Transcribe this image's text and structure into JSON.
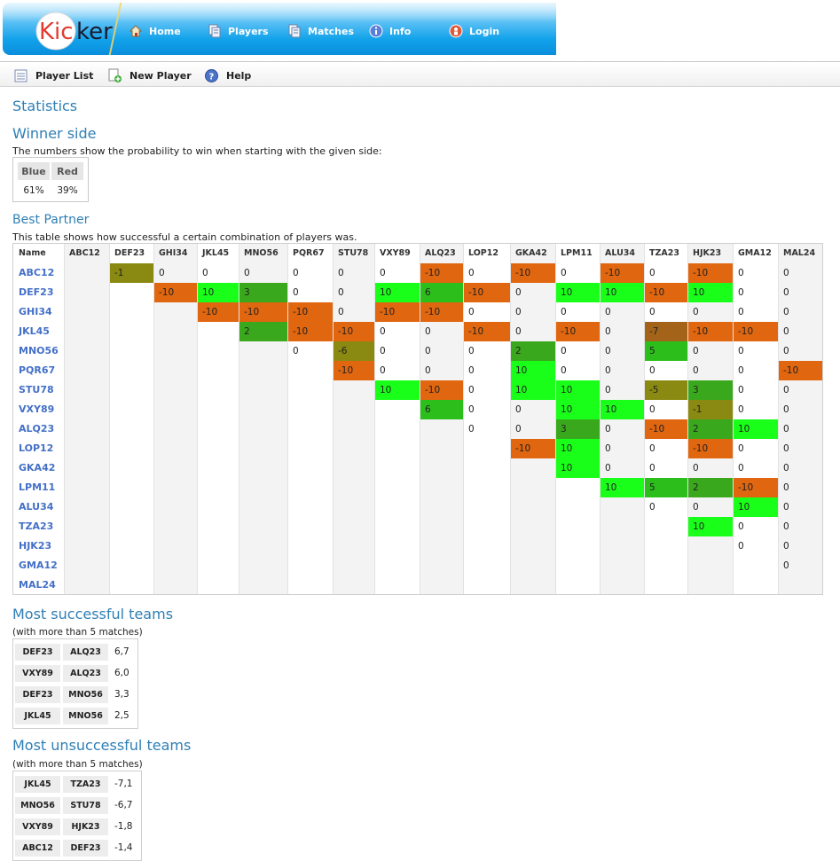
{
  "header": {
    "logo_text_left": "Kic",
    "logo_text_right": "ker",
    "nav": [
      {
        "label": "Home",
        "icon": "home-icon"
      },
      {
        "label": "Players",
        "icon": "document-icon"
      },
      {
        "label": "Matches",
        "icon": "document-icon"
      },
      {
        "label": "Info",
        "icon": "info-icon"
      },
      {
        "label": "Login",
        "icon": "login-icon"
      }
    ]
  },
  "toolbar": {
    "items": [
      {
        "label": "Player List",
        "icon": "list-icon"
      },
      {
        "label": "New Player",
        "icon": "add-document-icon"
      },
      {
        "label": "Help",
        "icon": "help-icon"
      }
    ]
  },
  "statistics": {
    "title": "Statistics",
    "winner_side": {
      "title": "Winner side",
      "description": "The numbers show the probability to win when starting with the given side:",
      "headers": [
        "Blue",
        "Red"
      ],
      "values": [
        "61%",
        "39%"
      ]
    },
    "best_partner": {
      "title": "Best Partner",
      "description": "This table shows how successful a certain combination of players was.",
      "name_header": "Name",
      "players": [
        "ABC12",
        "DEF23",
        "GHI34",
        "JKL45",
        "MNO56",
        "PQR67",
        "STU78",
        "VXY89",
        "ALQ23",
        "LOP12",
        "GKA42",
        "LPM11",
        "ALU34",
        "TZA23",
        "HJK23",
        "GMA12",
        "MAL24"
      ],
      "matrix": [
        [
          null,
          "-1",
          "0",
          "0",
          "0",
          "0",
          "0",
          "0",
          "-10",
          "0",
          "-10",
          "0",
          "-10",
          "0",
          "-10",
          "0",
          "0"
        ],
        [
          null,
          null,
          "-10",
          "10",
          "3",
          "0",
          "0",
          "10",
          "6",
          "-10",
          "0",
          "10",
          "10",
          "-10",
          "10",
          "0",
          "0"
        ],
        [
          null,
          null,
          null,
          "-10",
          "-10",
          "-10",
          "0",
          "-10",
          "-10",
          "0",
          "0",
          "0",
          "0",
          "0",
          "0",
          "0",
          "0"
        ],
        [
          null,
          null,
          null,
          null,
          "2",
          "-10",
          "-10",
          "0",
          "0",
          "-10",
          "0",
          "-10",
          "0",
          "-7",
          "-10",
          "-10",
          "0"
        ],
        [
          null,
          null,
          null,
          null,
          null,
          "0",
          "-6",
          "0",
          "0",
          "0",
          "2",
          "0",
          "0",
          "5",
          "0",
          "0",
          "0"
        ],
        [
          null,
          null,
          null,
          null,
          null,
          null,
          "-10",
          "0",
          "0",
          "0",
          "10",
          "0",
          "0",
          "0",
          "0",
          "0",
          "-10"
        ],
        [
          null,
          null,
          null,
          null,
          null,
          null,
          null,
          "10",
          "-10",
          "0",
          "10",
          "10",
          "0",
          "-5",
          "3",
          "0",
          "0"
        ],
        [
          null,
          null,
          null,
          null,
          null,
          null,
          null,
          null,
          "6",
          "0",
          "0",
          "10",
          "10",
          "0",
          "-1",
          "0",
          "0"
        ],
        [
          null,
          null,
          null,
          null,
          null,
          null,
          null,
          null,
          null,
          "0",
          "0",
          "3",
          "0",
          "-10",
          "2",
          "10",
          "0"
        ],
        [
          null,
          null,
          null,
          null,
          null,
          null,
          null,
          null,
          null,
          null,
          "-10",
          "10",
          "0",
          "0",
          "-10",
          "0",
          "0"
        ],
        [
          null,
          null,
          null,
          null,
          null,
          null,
          null,
          null,
          null,
          null,
          null,
          "10",
          "0",
          "0",
          "0",
          "0",
          "0"
        ],
        [
          null,
          null,
          null,
          null,
          null,
          null,
          null,
          null,
          null,
          null,
          null,
          null,
          "10",
          "5",
          "2",
          "-10",
          "0"
        ],
        [
          null,
          null,
          null,
          null,
          null,
          null,
          null,
          null,
          null,
          null,
          null,
          null,
          null,
          "0",
          "0",
          "10",
          "0"
        ],
        [
          null,
          null,
          null,
          null,
          null,
          null,
          null,
          null,
          null,
          null,
          null,
          null,
          null,
          null,
          "10",
          "0",
          "0"
        ],
        [
          null,
          null,
          null,
          null,
          null,
          null,
          null,
          null,
          null,
          null,
          null,
          null,
          null,
          null,
          null,
          "0",
          "0"
        ],
        [
          null,
          null,
          null,
          null,
          null,
          null,
          null,
          null,
          null,
          null,
          null,
          null,
          null,
          null,
          null,
          null,
          "0"
        ],
        [
          null,
          null,
          null,
          null,
          null,
          null,
          null,
          null,
          null,
          null,
          null,
          null,
          null,
          null,
          null,
          null,
          null
        ]
      ]
    },
    "most_successful": {
      "title": "Most successful teams",
      "note": "(with more than 5 matches)",
      "rows": [
        {
          "p1": "DEF23",
          "p2": "ALQ23",
          "score": "6,7"
        },
        {
          "p1": "VXY89",
          "p2": "ALQ23",
          "score": "6,0"
        },
        {
          "p1": "DEF23",
          "p2": "MNO56",
          "score": "3,3"
        },
        {
          "p1": "JKL45",
          "p2": "MNO56",
          "score": "2,5"
        }
      ]
    },
    "most_unsuccessful": {
      "title": "Most unsuccessful teams",
      "note": "(with more than 5 matches)",
      "rows": [
        {
          "p1": "JKL45",
          "p2": "TZA23",
          "score": "-7,1"
        },
        {
          "p1": "MNO56",
          "p2": "STU78",
          "score": "-6,7"
        },
        {
          "p1": "VXY89",
          "p2": "HJK23",
          "score": "-1,8"
        },
        {
          "p1": "ABC12",
          "p2": "DEF23",
          "score": "-1,4"
        }
      ]
    }
  },
  "colors": {
    "positive_strong": "#19ff19",
    "positive_mid": "#2cbf1c",
    "positive_weak": "#3aa81c",
    "neutral_mixed": "#8a8a12",
    "negative_mixed": "#a3641a",
    "negative_strong": "#e0660f",
    "heading": "#2f7fb5",
    "link": "#4470c8"
  }
}
